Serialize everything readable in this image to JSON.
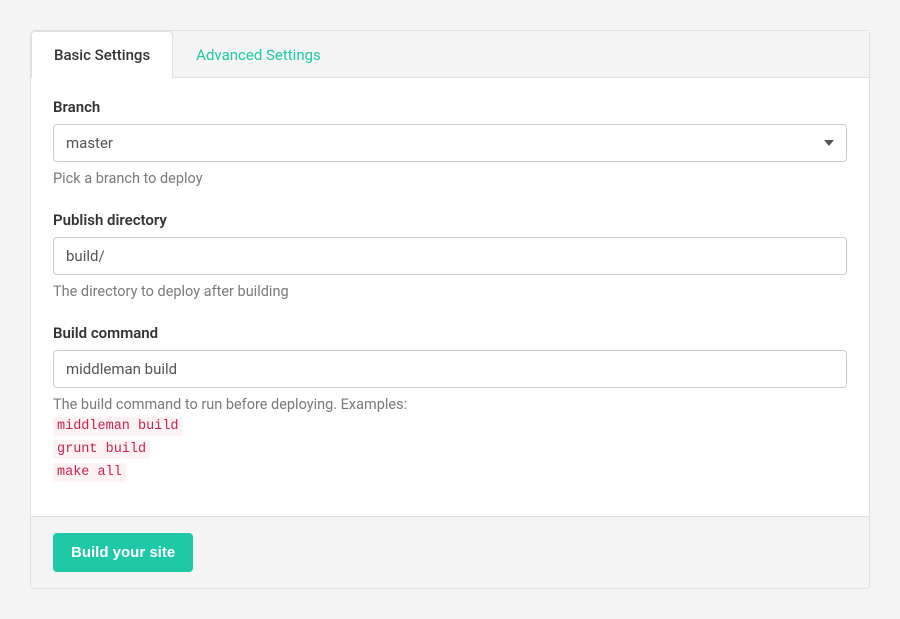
{
  "tabs": {
    "basic": "Basic Settings",
    "advanced": "Advanced Settings"
  },
  "form": {
    "branch": {
      "label": "Branch",
      "value": "master",
      "help": "Pick a branch to deploy"
    },
    "publishDirectory": {
      "label": "Publish directory",
      "value": "build/",
      "help": "The directory to deploy after building"
    },
    "buildCommand": {
      "label": "Build command",
      "value": "middleman build",
      "help": "The build command to run before deploying. Examples:",
      "examples": [
        "middleman build",
        "grunt build",
        "make all"
      ]
    }
  },
  "actions": {
    "submit": "Build your site"
  },
  "colors": {
    "accent": "#1fc8a7",
    "codeText": "#c7254e",
    "codeBg": "#fdf2f4"
  }
}
